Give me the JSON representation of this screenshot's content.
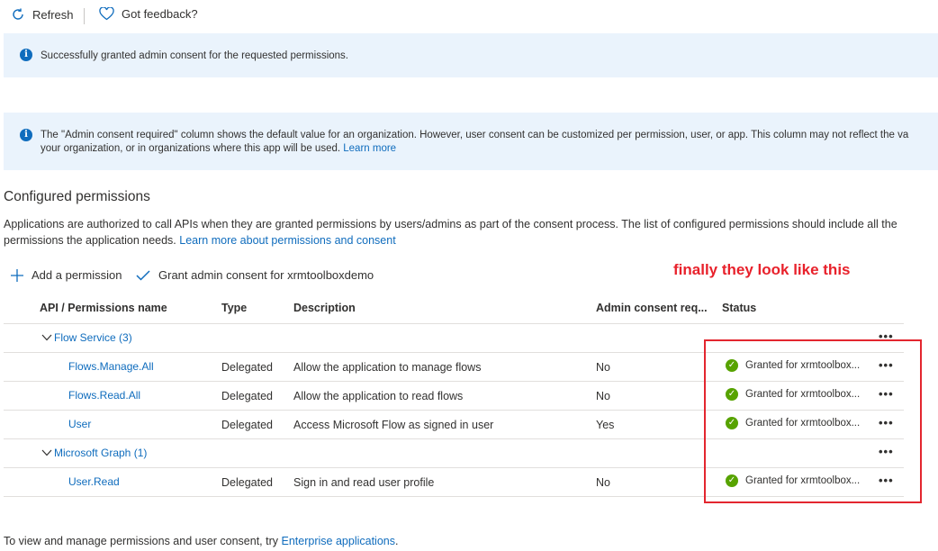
{
  "toolbar": {
    "refresh_label": "Refresh",
    "feedback_label": "Got feedback?"
  },
  "success_banner": {
    "text": "Successfully granted admin consent for the requested permissions."
  },
  "info_banner": {
    "line1": "The \"Admin consent required\" column shows the default value for an organization. However, user consent can be customized per permission, user, or app. This column may not reflect the va",
    "line2": "your organization, or in organizations where this app will be used.",
    "link": "Learn more"
  },
  "section": {
    "title": "Configured permissions",
    "desc": "Applications are authorized to call APIs when they are granted permissions by users/admins as part of the consent process. The list of configured permissions should include all the permissions the application needs.",
    "desc_link": "Learn more about permissions and consent"
  },
  "actions": {
    "add_label": "Add a permission",
    "grant_label": "Grant admin consent for xrmtoolboxdemo"
  },
  "annotation": "finally they look like this",
  "table": {
    "headers": {
      "name": "API / Permissions name",
      "type": "Type",
      "description": "Description",
      "admin": "Admin consent req...",
      "status": "Status"
    },
    "groups": [
      {
        "label": "Flow Service (3)"
      },
      {
        "label": "Microsoft Graph (1)"
      }
    ],
    "rows": [
      {
        "name": "Flows.Manage.All",
        "type": "Delegated",
        "description": "Allow the application to manage flows",
        "admin": "No",
        "status": "Granted for xrmtoolbox..."
      },
      {
        "name": "Flows.Read.All",
        "type": "Delegated",
        "description": "Allow the application to read flows",
        "admin": "No",
        "status": "Granted for xrmtoolbox..."
      },
      {
        "name": "User",
        "type": "Delegated",
        "description": "Access Microsoft Flow as signed in user",
        "admin": "Yes",
        "status": "Granted for xrmtoolbox..."
      },
      {
        "name": "User.Read",
        "type": "Delegated",
        "description": "Sign in and read user profile",
        "admin": "No",
        "status": "Granted for xrmtoolbox..."
      }
    ],
    "more_label": "•••"
  },
  "footer": {
    "text": "To view and manage permissions and user consent, try",
    "link": "Enterprise applications",
    "suffix": "."
  },
  "colors": {
    "link": "#0f6cbd",
    "banner_bg": "#eaf3fc",
    "success": "#57a300",
    "annotation": "#e3262f"
  }
}
